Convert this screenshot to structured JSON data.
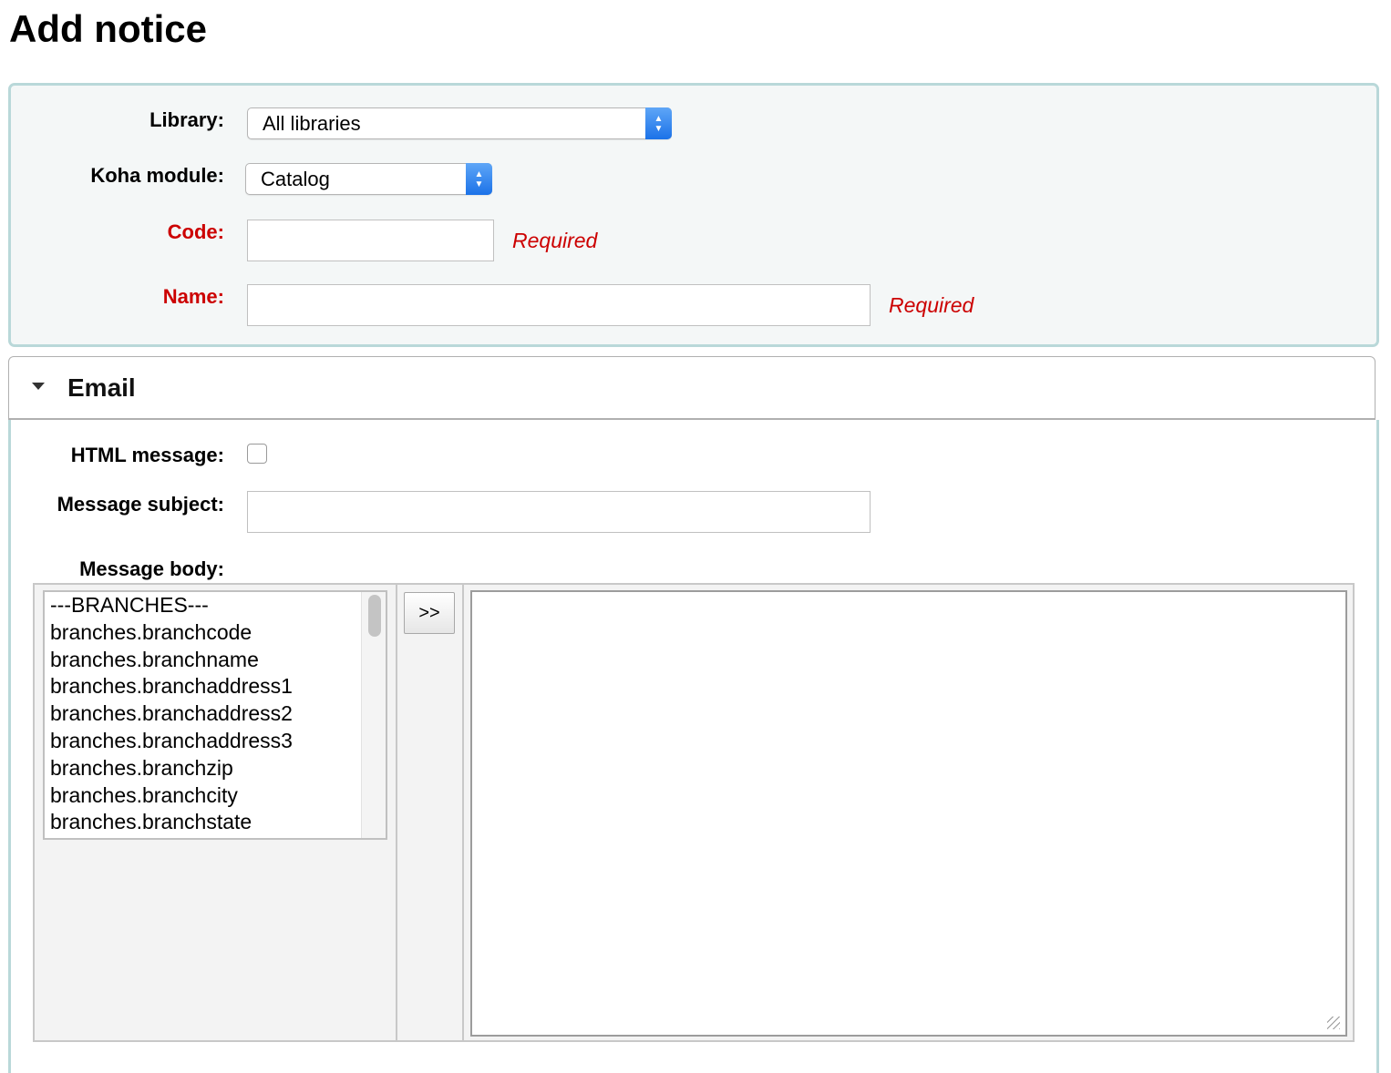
{
  "page": {
    "title": "Add notice"
  },
  "form": {
    "library": {
      "label": "Library:",
      "selected": "All libraries"
    },
    "module": {
      "label": "Koha module:",
      "selected": "Catalog"
    },
    "code": {
      "label": "Code:",
      "value": "",
      "required_note": "Required"
    },
    "name": {
      "label": "Name:",
      "value": "",
      "required_note": "Required"
    }
  },
  "email": {
    "title": "Email",
    "html_message": {
      "label": "HTML message:",
      "checked": false
    },
    "subject": {
      "label": "Message subject:",
      "value": ""
    },
    "body": {
      "label": "Message body:",
      "insert_button": ">>",
      "fields": [
        "---BRANCHES---",
        "branches.branchcode",
        "branches.branchname",
        "branches.branchaddress1",
        "branches.branchaddress2",
        "branches.branchaddress3",
        "branches.branchzip",
        "branches.branchcity",
        "branches.branchstate"
      ],
      "value": ""
    }
  },
  "colors": {
    "fieldset_border": "#b9d8d9",
    "fieldset_bg": "#f4f7f7",
    "required": "#cc0000",
    "select_arrow": "#1b72e8"
  }
}
